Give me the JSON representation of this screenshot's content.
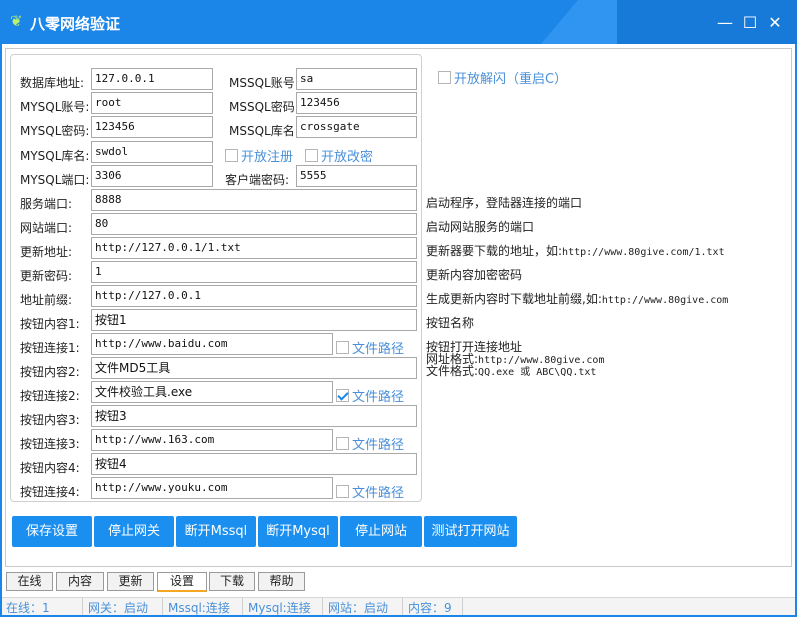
{
  "window": {
    "title": "八零网络验证",
    "app_icon": "leaf-icon",
    "minimize_glyph": "—",
    "maximize_glyph": "☐",
    "close_glyph": "✕",
    "accent_color": "#1c86e8"
  },
  "settings": {
    "db_address": {
      "label": "数据库地址:",
      "value": "127.0.0.1"
    },
    "mysql_account": {
      "label": "MYSQL账号:",
      "value": "root"
    },
    "mysql_password": {
      "label": "MYSQL密码:",
      "value": "123456"
    },
    "mysql_db": {
      "label": "MYSQL库名:",
      "value": "swdol"
    },
    "mysql_port": {
      "label": "MYSQL端口:",
      "value": "3306"
    },
    "mssql_account": {
      "label": "MSSQL账号:",
      "value": "sa"
    },
    "mssql_password": {
      "label": "MSSQL密码:",
      "value": "123456"
    },
    "mssql_db": {
      "label": "MSSQL库名:",
      "value": "crossgate"
    },
    "client_password": {
      "label": "客户端密码:",
      "value": "5555"
    },
    "open_register": {
      "label": "开放注册",
      "checked": false
    },
    "open_change_pw": {
      "label": "开放改密",
      "checked": false
    },
    "open_flash": {
      "label": "开放解闪（重启C）",
      "checked": false
    },
    "service_port": {
      "label": "服务端口:",
      "value": "8888",
      "hint": "启动程序，登陆器连接的端口"
    },
    "web_port": {
      "label": "网站端口:",
      "value": "80",
      "hint": "启动网站服务的端口"
    },
    "update_url": {
      "label": "更新地址:",
      "value": "http://127.0.0.1/1.txt",
      "hint_prefix": "更新器要下载的地址，如:",
      "hint_url": "http://www.80give.com/1.txt"
    },
    "update_password": {
      "label": "更新密码:",
      "value": "1",
      "hint": "更新内容加密密码"
    },
    "url_prefix": {
      "label": "地址前缀:",
      "value": "http://127.0.0.1",
      "hint_prefix": "生成更新内容时下载地址前缀,如:",
      "hint_url": "http://www.80give.com"
    },
    "buttons": [
      {
        "content_label": "按钮内容1:",
        "content": "按钮1",
        "link_label": "按钮连接1:",
        "link": "http://www.baidu.com",
        "path_label": "文件路径",
        "path_checked": false
      },
      {
        "content_label": "按钮内容2:",
        "content": "文件MD5工具",
        "link_label": "按钮连接2:",
        "link": "文件校验工具.exe",
        "path_label": "文件路径",
        "path_checked": true
      },
      {
        "content_label": "按钮内容3:",
        "content": "按钮3",
        "link_label": "按钮连接3:",
        "link": "http://www.163.com",
        "path_label": "文件路径",
        "path_checked": false
      },
      {
        "content_label": "按钮内容4:",
        "content": "按钮4",
        "link_label": "按钮连接4:",
        "link": "http://www.youku.com",
        "path_label": "文件路径",
        "path_checked": false
      }
    ],
    "button_hints": {
      "name": "按钮名称",
      "link": "按钮打开连接地址",
      "url_format_label": "网址格式:",
      "url_format": "http://www.80give.com",
      "file_format_label": "文件格式:",
      "file_format": "QQ.exe 或 ABC\\QQ.txt"
    }
  },
  "actions": {
    "save": "保存设置",
    "stop_gateway": "停止网关",
    "disconnect_mssql": "断开Mssql",
    "disconnect_mysql": "断开Mysql",
    "stop_website": "停止网站",
    "test_website": "测试打开网站"
  },
  "tabs": {
    "online": "在线",
    "content": "内容",
    "update": "更新",
    "settings": "设置",
    "download": "下载",
    "help": "帮助",
    "active": "设置"
  },
  "status": {
    "online": "在线：1",
    "gateway": "网关：启动",
    "mssql": "Mssql:连接",
    "mysql": "Mysql:连接",
    "website": "网站：启动",
    "content": "内容：9"
  }
}
